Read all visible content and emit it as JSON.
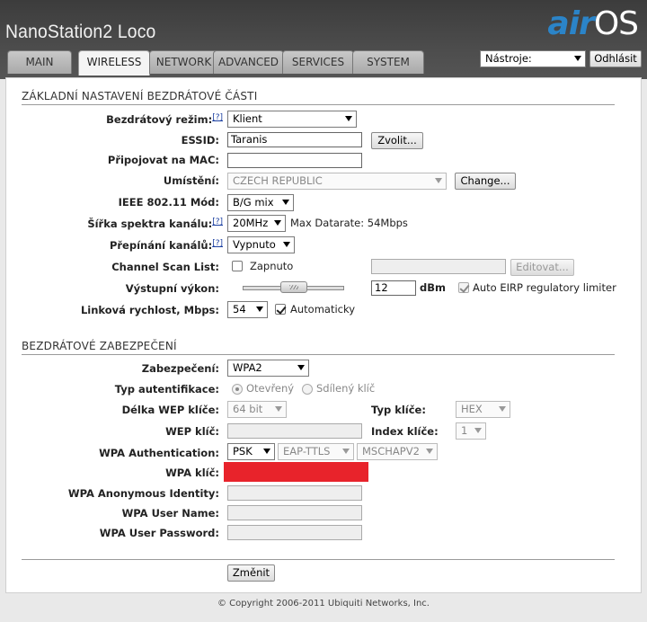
{
  "header": {
    "device_name": "NanoStation2 Loco",
    "logo_air": "air",
    "logo_os": "OS",
    "tools_select": "Nástroje:",
    "logout_label": "Odhlásit"
  },
  "tabs": [
    {
      "label": "MAIN"
    },
    {
      "label": "WIRELESS",
      "active": true
    },
    {
      "label": "NETWORK"
    },
    {
      "label": "ADVANCED"
    },
    {
      "label": "SERVICES"
    },
    {
      "label": "SYSTEM"
    }
  ],
  "basic": {
    "title": "ZÁKLADNÍ NASTAVENÍ BEZDRÁTOVÉ ČÁSTI",
    "help_mark": "[?]",
    "mode_label": "Bezdrátový režim:",
    "mode_value": "Klient",
    "essid_label": "ESSID:",
    "essid_value": "Taranis",
    "essid_button": "Zvolit...",
    "mac_label": "Připojovat na MAC:",
    "mac_value": "",
    "country_label": "Umístění:",
    "country_value": "CZECH REPUBLIC",
    "country_button": "Change...",
    "ieee_label": "IEEE 802.11 Mód:",
    "ieee_value": "B/G mix",
    "width_label": "Šířka spektra kanálu:",
    "width_value": "20MHz",
    "max_datarate": "Max Datarate: 54Mbps",
    "channel_label": "Přepínání kanálů:",
    "channel_value": "Vypnuto",
    "scan_label": "Channel Scan List:",
    "scan_checkbox_label": "Zapnuto",
    "scan_checked": false,
    "scan_list_value": "",
    "scan_edit_button": "Editovat...",
    "power_label": "Výstupní výkon:",
    "power_value": "12",
    "power_unit": "dBm",
    "power_level_fraction": 0.5,
    "eirp_label": "Auto EIRP regulatory limiter",
    "eirp_checked": true,
    "rate_label": "Linková rychlost, Mbps:",
    "rate_value": "54",
    "rate_auto_label": "Automaticky",
    "rate_auto_checked": true
  },
  "security": {
    "title": "BEZDRÁTOVÉ ZABEZPEČENÍ",
    "security_label": "Zabezpečení:",
    "security_value": "WPA2",
    "auth_type_label": "Typ autentifikace:",
    "auth_open_label": "Otevřený",
    "auth_shared_label": "Sdílený klíč",
    "auth_selected": "Otevřený",
    "wep_length_label": "Délka WEP klíče:",
    "wep_length_value": "64 bit",
    "key_type_label": "Typ klíče:",
    "key_type_value": "HEX",
    "wep_key_label": "WEP klíč:",
    "wep_key_value": "",
    "key_index_label": "Index klíče:",
    "key_index_value": "1",
    "wpa_auth_label": "WPA Authentication:",
    "wpa_auth_value": "PSK",
    "eap_value": "EAP-TTLS",
    "inner_value": "MSCHAPV2",
    "wpa_key_label": "WPA klíč:",
    "wpa_anon_label": "WPA Anonymous Identity:",
    "wpa_anon_value": "",
    "wpa_user_label": "WPA User Name:",
    "wpa_user_value": "",
    "wpa_pass_label": "WPA User Password:",
    "wpa_pass_value": ""
  },
  "actions": {
    "save_label": "Změnit"
  },
  "footer": {
    "copyright": "© Copyright 2006-2011 Ubiquiti Networks, Inc."
  },
  "colors": {
    "header_bg": "#444444",
    "logo_accent": "#2b84c8",
    "redaction": "#e8232b"
  }
}
